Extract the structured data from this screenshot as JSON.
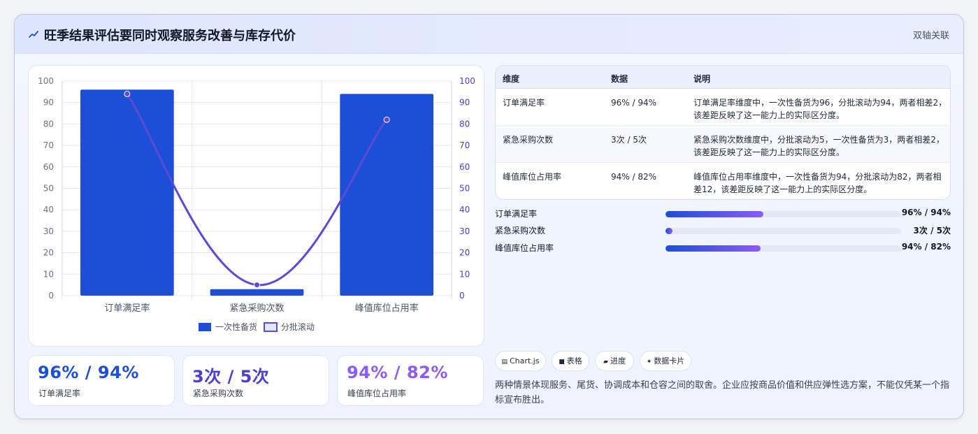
{
  "header": {
    "title": "旺季结果评估要同时观察服务改善与库存代价",
    "badge": "双轴关联"
  },
  "chart_data": {
    "type": "bar",
    "categories": [
      "订单满足率",
      "紧急采购次数",
      "峰值库位占用率"
    ],
    "series": [
      {
        "name": "一次性备货",
        "type": "bar",
        "axis": "left",
        "values": [
          96,
          3,
          94
        ],
        "color": "#1d4ed8"
      },
      {
        "name": "分批滚动",
        "type": "line",
        "axis": "right",
        "values": [
          94,
          5,
          82
        ],
        "color": "#5b4bd4"
      }
    ],
    "ylim": [
      0,
      100
    ],
    "y2lim": [
      0,
      100
    ],
    "yticks": [
      "0",
      "10",
      "20",
      "30",
      "40",
      "50",
      "60",
      "70",
      "80",
      "90",
      "100"
    ],
    "legend": "bottom",
    "grid": true
  },
  "kpis": [
    {
      "value": "96% / 94%",
      "label": "订单满足率",
      "color": "#1d4ed8"
    },
    {
      "value": "3次 / 5次",
      "label": "紧急采购次数",
      "color": "#4c3fc9"
    },
    {
      "value": "94% / 82%",
      "label": "峰值库位占用率",
      "color": "#8b5cf6"
    }
  ],
  "table": {
    "headers": [
      "维度",
      "数据",
      "说明"
    ],
    "rows": [
      {
        "dim": "订单满足率",
        "data": "96% / 94%",
        "desc1": "订单满足率维度中，一次性备货为96，分批滚动为94，两者相差2，",
        "desc2": "该差距反映了这一能力上的实际区分度。"
      },
      {
        "dim": "紧急采购次数",
        "data": "3次 / 5次",
        "desc1": "紧急采购次数维度中，分批滚动为5，一次性备货为3，两者相差2，",
        "desc2": "该差距反映了这一能力上的实际区分度。"
      },
      {
        "dim": "峰值库位占用率",
        "data": "94% / 82%",
        "desc1": "峰值库位占用率维度中，一次性备货为94，分批滚动为82，两者相",
        "desc2": "差12，该差距反映了这一能力上的实际区分度。"
      }
    ]
  },
  "progress": [
    {
      "label": "订单满足率",
      "value": "96% / 94%",
      "fraction": 0.415
    },
    {
      "label": "紧急采购次数",
      "value": "3次 / 5次",
      "fraction": 0.03
    },
    {
      "label": "峰值库位占用率",
      "value": "94% / 82%",
      "fraction": 0.405
    }
  ],
  "chips": [
    {
      "icon": "chart-icon",
      "label": "Chart.js"
    },
    {
      "icon": "table-icon",
      "label": "表格"
    },
    {
      "icon": "progress-icon",
      "label": "进度"
    },
    {
      "icon": "sparkle-icon",
      "label": "数据卡片"
    }
  ],
  "note": "两种情景体现服务、尾货、协调成本和仓容之间的取舍。企业应按商品价值和供应弹性选方案，不能仅凭某一个指标宣布胜出。"
}
